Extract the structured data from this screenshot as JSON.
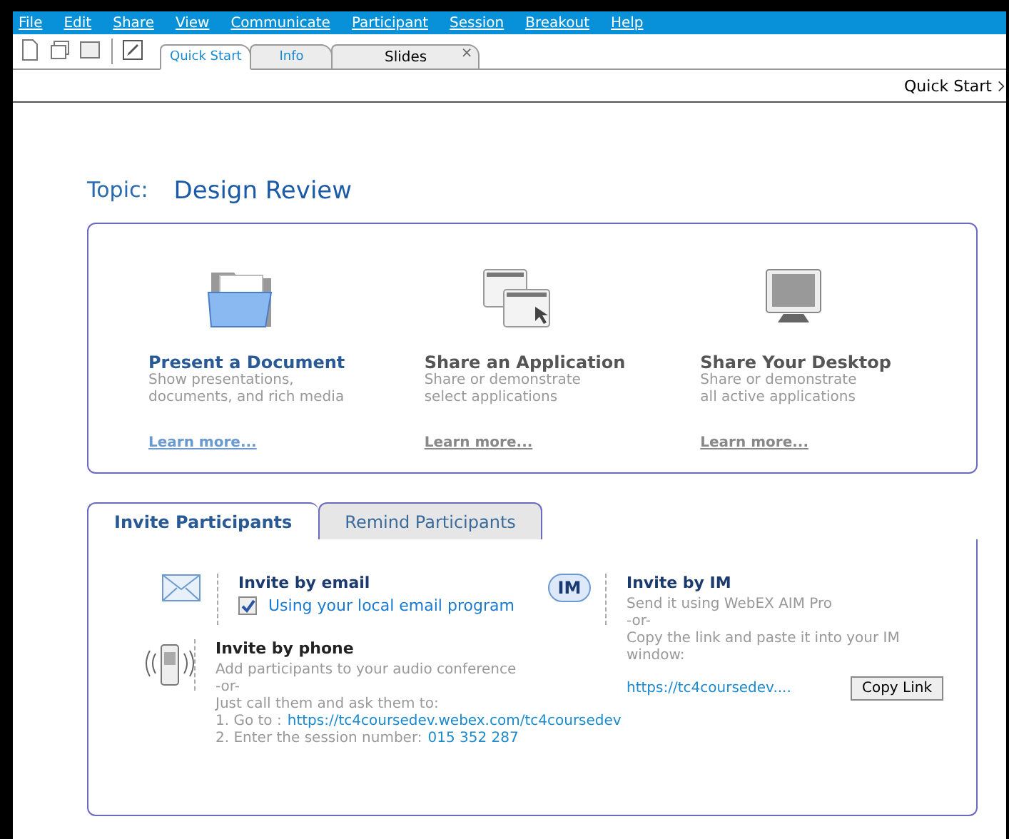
{
  "menu": [
    {
      "label": "File"
    },
    {
      "label": "Edit"
    },
    {
      "label": "Share"
    },
    {
      "label": "View"
    },
    {
      "label": "Communicate"
    },
    {
      "label": "Participant"
    },
    {
      "label": "Session"
    },
    {
      "label": "Breakout"
    },
    {
      "label": "Help"
    }
  ],
  "tabs": [
    {
      "label": "Quick Start",
      "selected": true
    },
    {
      "label": "Info",
      "selected": false
    },
    {
      "label": "Slides",
      "selected": false,
      "close": "×"
    }
  ],
  "breadcrumb": "Quick Start",
  "topic": {
    "label": "Topic:",
    "value": "Design Review"
  },
  "share_options": [
    {
      "kind": "folder",
      "title": "Present a Document",
      "description": "Show presentations,\ndocuments, and rich media",
      "link": "Learn more...",
      "selected": true
    },
    {
      "kind": "application",
      "title": "Share an Application",
      "description": "Share or demonstrate\nselect applications",
      "link": "Learn more...",
      "selected": false
    },
    {
      "kind": "desktop",
      "title": "Share Your Desktop",
      "description": "Share or demonstrate\nall active applications",
      "link": "Learn more...",
      "selected": false
    }
  ],
  "invite_tabs": [
    {
      "label": "Invite Participants",
      "selected": true
    },
    {
      "label": "Remind Participants",
      "selected": false
    }
  ],
  "invite_email": {
    "title": "Invite by email",
    "option": {
      "label": "Using your local email program",
      "checked": true
    }
  },
  "invite_phone": {
    "title": "Invite by phone",
    "description": "Add participants to your audio conference\n-or-\nJust call them and ask them to:",
    "goto_label": "1. Go to :",
    "goto_link": "https://tc4coursedev.webex.com/tc4coursedev",
    "session_label": "2. Enter the session number:",
    "session_number": "015 352 287"
  },
  "invite_im": {
    "badge": "IM",
    "title": "Invite by IM",
    "description": "Send it using WebEX AIM Pro\n-or-\nCopy the link and paste it into your IM window:",
    "link": "https://tc4coursedev....",
    "button": "Copy Link"
  }
}
